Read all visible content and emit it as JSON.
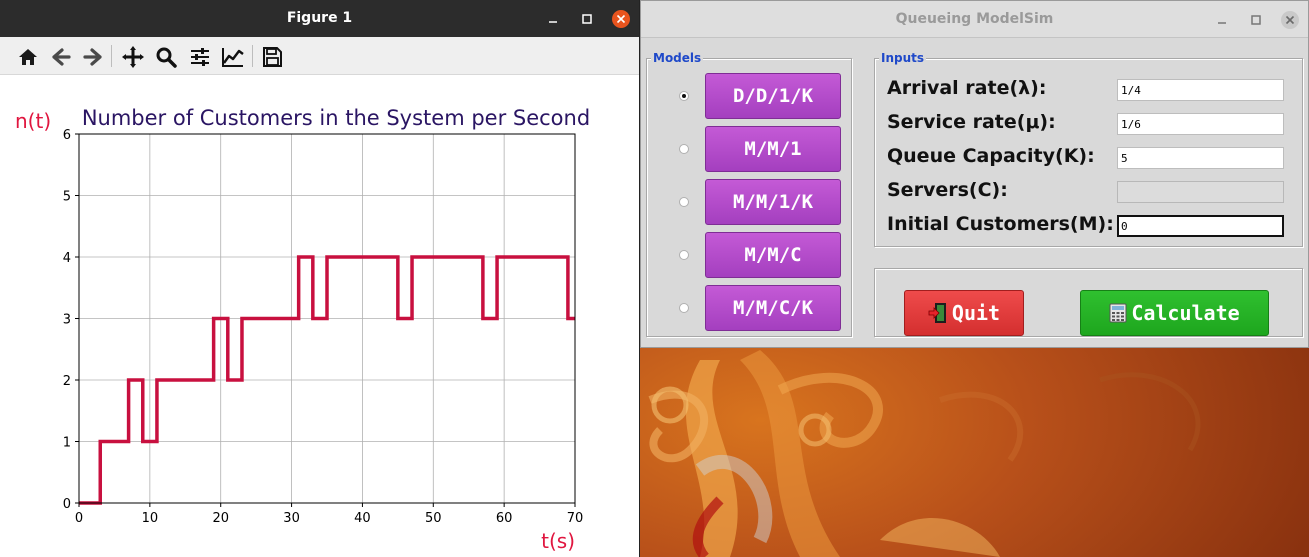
{
  "figure_window": {
    "title": "Figure 1",
    "toolbar": [
      "home-icon",
      "back-icon",
      "forward-icon",
      "pan-icon",
      "zoom-icon",
      "configure-subplots-icon",
      "edit-axes-icon",
      "save-icon"
    ]
  },
  "chart_data": {
    "type": "line",
    "drawstyle": "steps-post",
    "title": "Number of Customers in the System per Second",
    "xlabel": "t(s)",
    "ylabel": "n(t)",
    "xlim": [
      0,
      70
    ],
    "ylim": [
      0,
      6
    ],
    "xticks": [
      0,
      10,
      20,
      30,
      40,
      50,
      60,
      70
    ],
    "yticks": [
      0,
      1,
      2,
      3,
      4,
      5,
      6
    ],
    "grid": true,
    "color": "#c8103f",
    "title_color": "#2a1563",
    "label_color": "#e0163f",
    "series": [
      {
        "x": [
          0,
          3,
          7,
          9,
          11,
          19,
          21,
          23,
          31,
          33,
          35,
          45,
          47,
          57,
          59,
          69,
          70
        ],
        "y": [
          0,
          1,
          2,
          1,
          2,
          3,
          2,
          3,
          4,
          3,
          4,
          3,
          4,
          3,
          4,
          3,
          3
        ]
      }
    ]
  },
  "qm_window": {
    "title": "Queueing ModelSim",
    "models": {
      "legend": "Models",
      "options": [
        {
          "label": "D/D/1/K",
          "selected": true
        },
        {
          "label": "M/M/1",
          "selected": false
        },
        {
          "label": "M/M/1/K",
          "selected": false
        },
        {
          "label": "M/M/C",
          "selected": false
        },
        {
          "label": "M/M/C/K",
          "selected": false
        }
      ]
    },
    "inputs": {
      "legend": "Inputs",
      "fields": [
        {
          "label": "Arrival rate(λ):",
          "value": "1/4"
        },
        {
          "label": "Service rate(μ):",
          "value": "1/6"
        },
        {
          "label": "Queue Capacity(K):",
          "value": "5"
        },
        {
          "label": "Servers(C):",
          "value": ""
        },
        {
          "label": "Initial Customers(M):",
          "value": "0"
        }
      ]
    },
    "actions": {
      "quit_label": "Quit",
      "calculate_label": "Calculate",
      "quit_color": "#e03a3a",
      "calculate_color": "#22b022"
    }
  }
}
